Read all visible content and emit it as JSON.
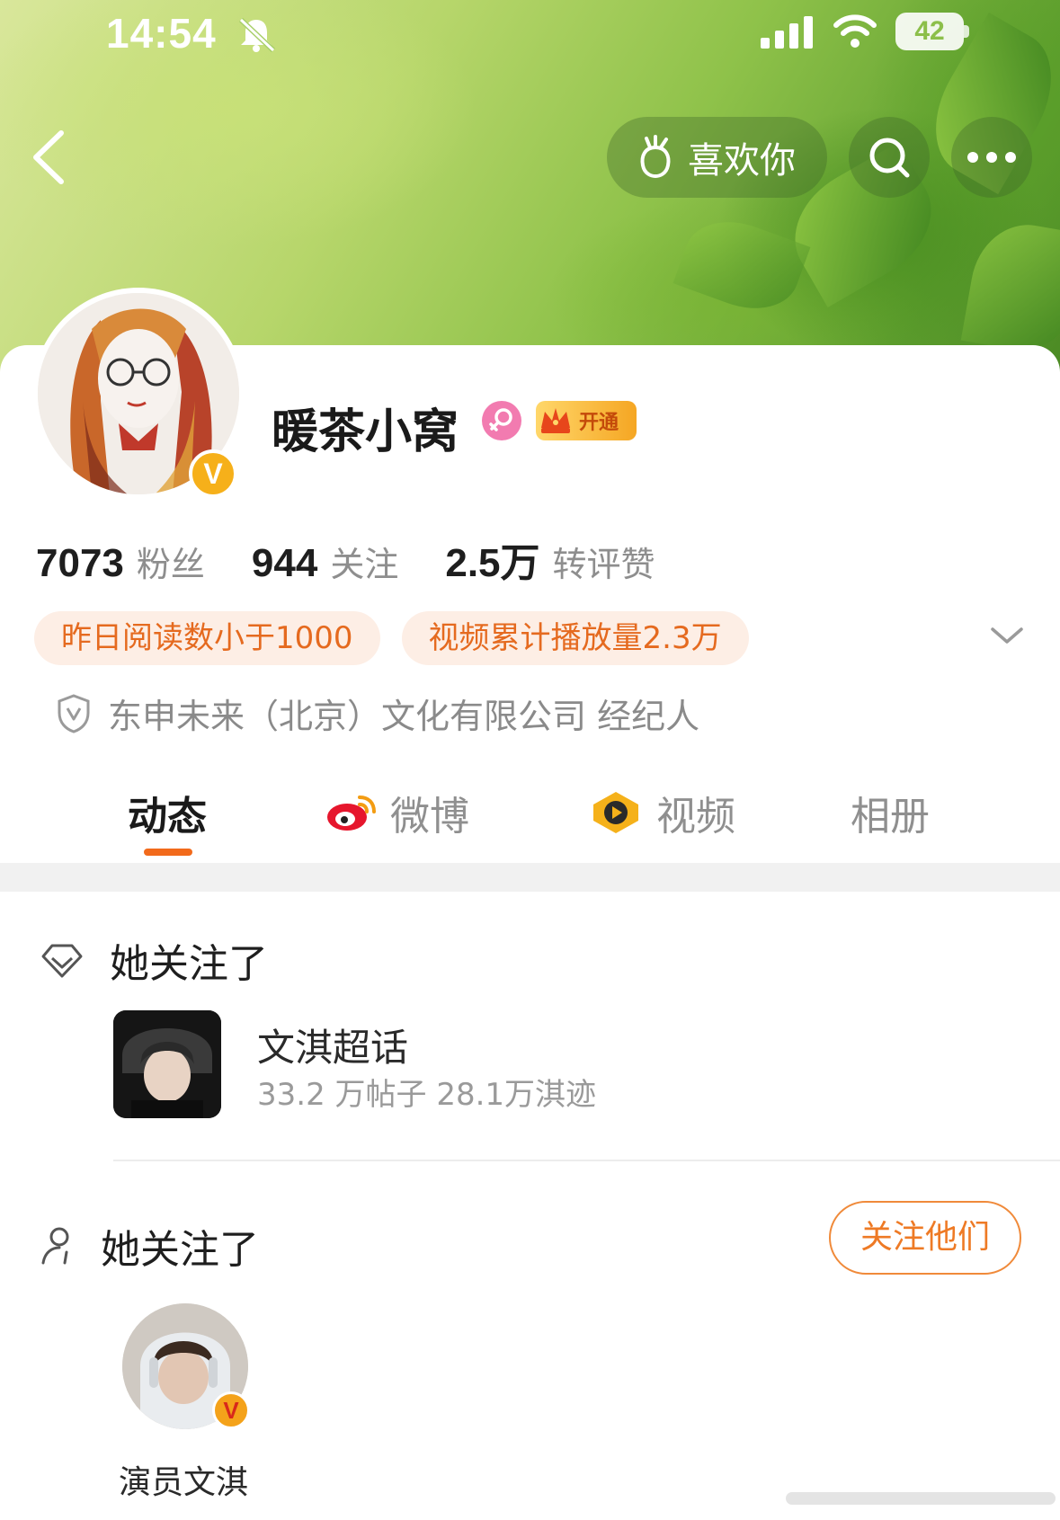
{
  "status_bar": {
    "time": "14:54",
    "battery": "42"
  },
  "header": {
    "like_label": "喜欢你"
  },
  "profile": {
    "username": "暖茶小窝",
    "vip_label": "开通",
    "verified_badge": "V",
    "stats": [
      {
        "value": "7073",
        "label": "粉丝"
      },
      {
        "value": "944",
        "label": "关注"
      },
      {
        "value": "2.5万",
        "label": "转评赞"
      }
    ],
    "tags": [
      "昨日阅读数小于1000",
      "视频累计播放量2.3万"
    ],
    "certification": "东申未来（北京）文化有限公司 经纪人"
  },
  "tabs": [
    {
      "label": "动态",
      "active": true
    },
    {
      "label": "微博",
      "active": false
    },
    {
      "label": "视频",
      "active": false
    },
    {
      "label": "相册",
      "active": false
    }
  ],
  "feed": {
    "supertopic_section": {
      "title": "她关注了",
      "topic_name": "文淇超话",
      "topic_meta": "33.2 万帖子 28.1万淇迹"
    },
    "user_section": {
      "title": "她关注了",
      "follow_button": "关注他们",
      "person_name": "演员文淇",
      "person_badge": "V"
    }
  },
  "colors": {
    "accent": "#f26a1b",
    "tag_bg": "#fdeee5",
    "tag_text": "#e56a1f",
    "vip_gold": "#f5a623"
  }
}
